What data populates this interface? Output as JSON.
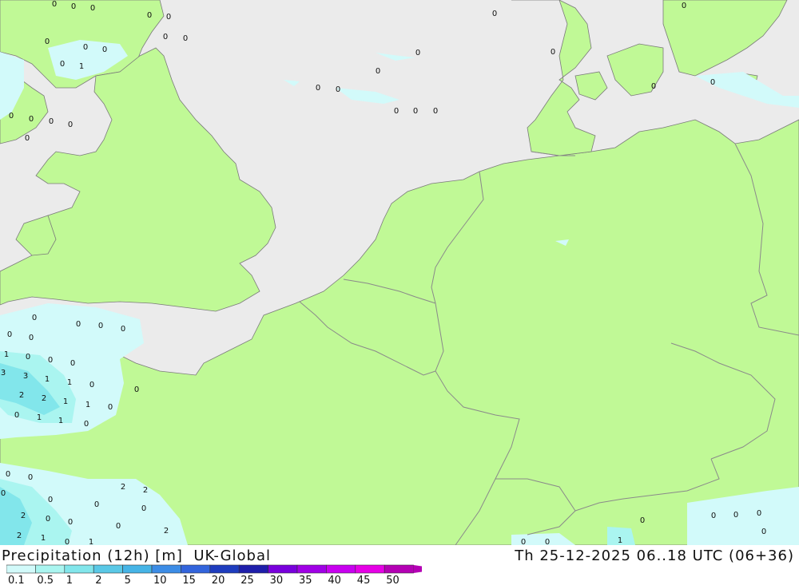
{
  "map": {
    "title": "Precipitation (12h) [m]",
    "model": "UK-Global",
    "valid_time": "Th 25-12-2025 06..18 UTC (06+36)",
    "colors": {
      "sea": "#ebebeb",
      "land": "#c0f996",
      "border": "#8a8a8a",
      "coast": "#7a7a7a"
    },
    "legend": {
      "labels": [
        "0.1",
        "0.5",
        "1",
        "2",
        "5",
        "10",
        "15",
        "20",
        "25",
        "30",
        "35",
        "40",
        "45",
        "50"
      ],
      "colors": [
        "#d2fafa",
        "#aaf5f0",
        "#82e6eb",
        "#5ac8e6",
        "#46b4e6",
        "#3c8ce6",
        "#3264dc",
        "#1e3cbe",
        "#1e1eaa",
        "#7800dc",
        "#a000e6",
        "#c800f0",
        "#e600e6",
        "#b400b4"
      ]
    },
    "point_values": [
      "0",
      "0",
      "0",
      "0",
      "0",
      "0",
      "0",
      "0",
      "1",
      "0",
      "0",
      "0",
      "0",
      "0",
      "0",
      "0",
      "0",
      "0",
      "0",
      "0",
      "0",
      "0",
      "0",
      "0",
      "0",
      "0",
      "0",
      "0",
      "0",
      "0",
      "0",
      "0",
      "0",
      "0",
      "0",
      "1",
      "0",
      "0",
      "0",
      "3",
      "3",
      "1",
      "1",
      "0",
      "0",
      "2",
      "2",
      "1",
      "1",
      "0",
      "0",
      "1",
      "1",
      "0",
      "0",
      "0",
      "2",
      "2",
      "0",
      "0",
      "0",
      "0",
      "2",
      "0",
      "0",
      "0",
      "2",
      "2",
      "1",
      "0",
      "1",
      "0",
      "0",
      "0",
      "0",
      "0",
      "0",
      "0",
      "1"
    ]
  }
}
